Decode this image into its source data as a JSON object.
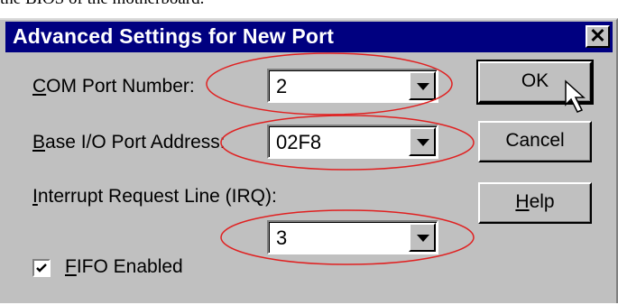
{
  "top_text": "the BIOS of the motherboard.",
  "dialog": {
    "title": "Advanced Settings for New Port",
    "close_label": "✕",
    "fields": [
      {
        "label": "COM Port Number:",
        "value": "2"
      },
      {
        "label": "Base I/O Port Address:",
        "value": "02F8"
      },
      {
        "label": "Interrupt Request Line (IRQ):",
        "value": "3"
      }
    ],
    "fifo": {
      "label": "FIFO Enabled",
      "checked": true
    },
    "buttons": {
      "ok": "OK",
      "cancel": "Cancel",
      "help": "Help"
    }
  },
  "colors": {
    "titlebar": "#000080",
    "face": "#c0c0c0",
    "highlight_ellipse": "#e02020"
  },
  "icons": [
    "close-icon",
    "dropdown-arrow-icon",
    "checkmark-icon",
    "mouse-cursor-icon"
  ]
}
